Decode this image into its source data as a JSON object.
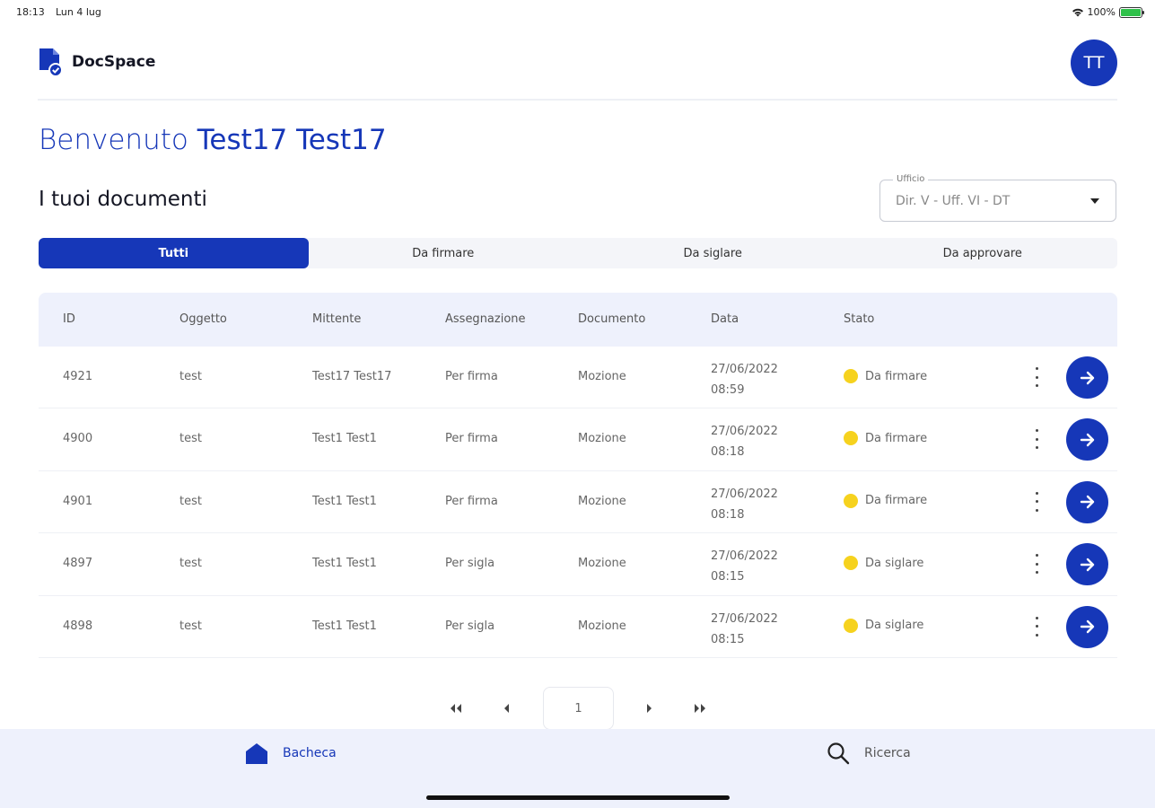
{
  "status_bar": {
    "time": "18:13",
    "date": "Lun 4 lug",
    "battery": "100%"
  },
  "header": {
    "app_name": "DocSpace",
    "avatar_initials": "TT"
  },
  "welcome": {
    "greeting": "Benvenuto",
    "user_name": "Test17 Test17"
  },
  "section_title": "I tuoi documenti",
  "office_select": {
    "label": "Ufficio",
    "value": "Dir. V - Uff. VI - DT"
  },
  "tabs": [
    {
      "label": "Tutti",
      "active": true
    },
    {
      "label": "Da firmare",
      "active": false
    },
    {
      "label": "Da siglare",
      "active": false
    },
    {
      "label": "Da approvare",
      "active": false
    }
  ],
  "table": {
    "columns": [
      "ID",
      "Oggetto",
      "Mittente",
      "Assegnazione",
      "Documento",
      "Data",
      "Stato"
    ],
    "rows": [
      {
        "id": "4921",
        "oggetto": "test",
        "mittente": "Test17 Test17",
        "assegnazione": "Per firma",
        "documento": "Mozione",
        "date": "27/06/2022",
        "time": "08:59",
        "stato": "Da firmare"
      },
      {
        "id": "4900",
        "oggetto": "test",
        "mittente": "Test1 Test1",
        "assegnazione": "Per firma",
        "documento": "Mozione",
        "date": "27/06/2022",
        "time": "08:18",
        "stato": "Da firmare"
      },
      {
        "id": "4901",
        "oggetto": "test",
        "mittente": "Test1 Test1",
        "assegnazione": "Per firma",
        "documento": "Mozione",
        "date": "27/06/2022",
        "time": "08:18",
        "stato": "Da firmare"
      },
      {
        "id": "4897",
        "oggetto": "test",
        "mittente": "Test1 Test1",
        "assegnazione": "Per sigla",
        "documento": "Mozione",
        "date": "27/06/2022",
        "time": "08:15",
        "stato": "Da siglare"
      },
      {
        "id": "4898",
        "oggetto": "test",
        "mittente": "Test1 Test1",
        "assegnazione": "Per sigla",
        "documento": "Mozione",
        "date": "27/06/2022",
        "time": "08:15",
        "stato": "Da siglare"
      }
    ]
  },
  "pagination": {
    "current_page": "1"
  },
  "bottom_nav": {
    "home_label": "Bacheca",
    "search_label": "Ricerca"
  },
  "colors": {
    "primary": "#1637b8",
    "status_pending": "#f6d21e",
    "table_header_bg": "#eef1fc"
  },
  "icons": {
    "logo": "document-check-icon",
    "row_menu": "kebab-menu-icon",
    "row_action": "arrow-right-icon",
    "pagination": [
      "first-page-icon",
      "prev-page-icon",
      "next-page-icon",
      "last-page-icon"
    ],
    "nav": [
      "home-icon",
      "search-icon"
    ]
  }
}
